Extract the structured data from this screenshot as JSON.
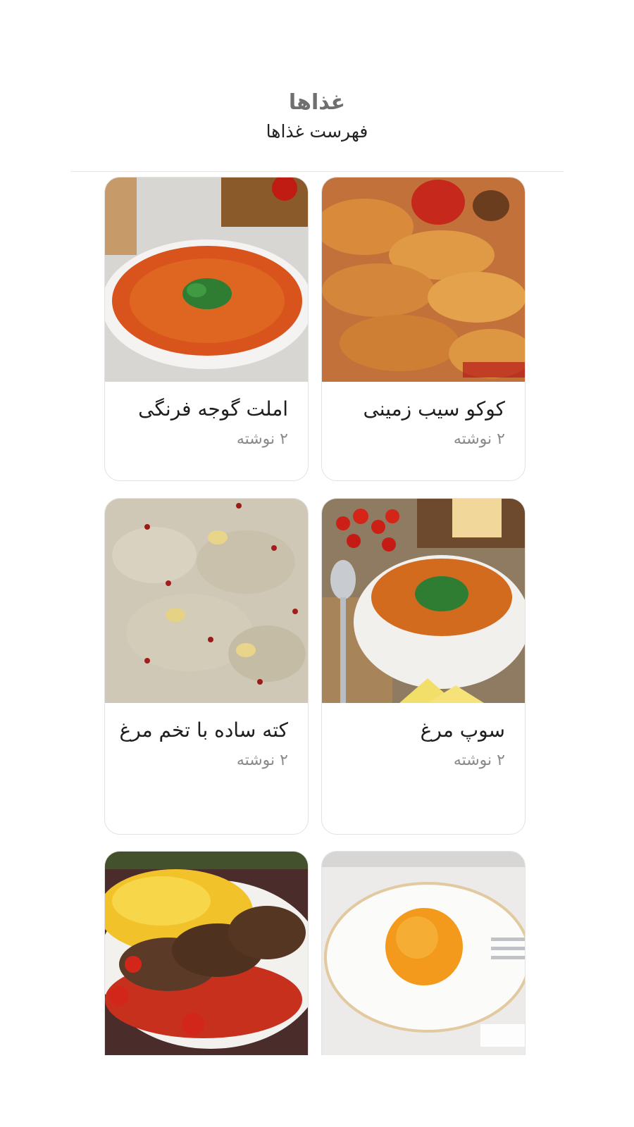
{
  "page": {
    "title": "غذاها",
    "subtitle": "فهرست غذاها"
  },
  "items": [
    {
      "name": "کوکو سیب زمینی",
      "count": "۲ نوشته",
      "image": "potato-kuku-photo"
    },
    {
      "name": "املت گوجه فرنگی",
      "count": "۲ نوشته",
      "image": "tomato-omelette-photo"
    },
    {
      "name": "سوپ مرغ",
      "count": "۲ نوشته",
      "image": "chicken-soup-photo"
    },
    {
      "name": "کته ساده با تخم مرغ",
      "count": "۲ نوشته",
      "image": "rice-with-egg-photo"
    },
    {
      "name": "",
      "count": "",
      "image": "fried-egg-photo"
    },
    {
      "name": "",
      "count": "",
      "image": "kabab-rice-photo"
    }
  ]
}
